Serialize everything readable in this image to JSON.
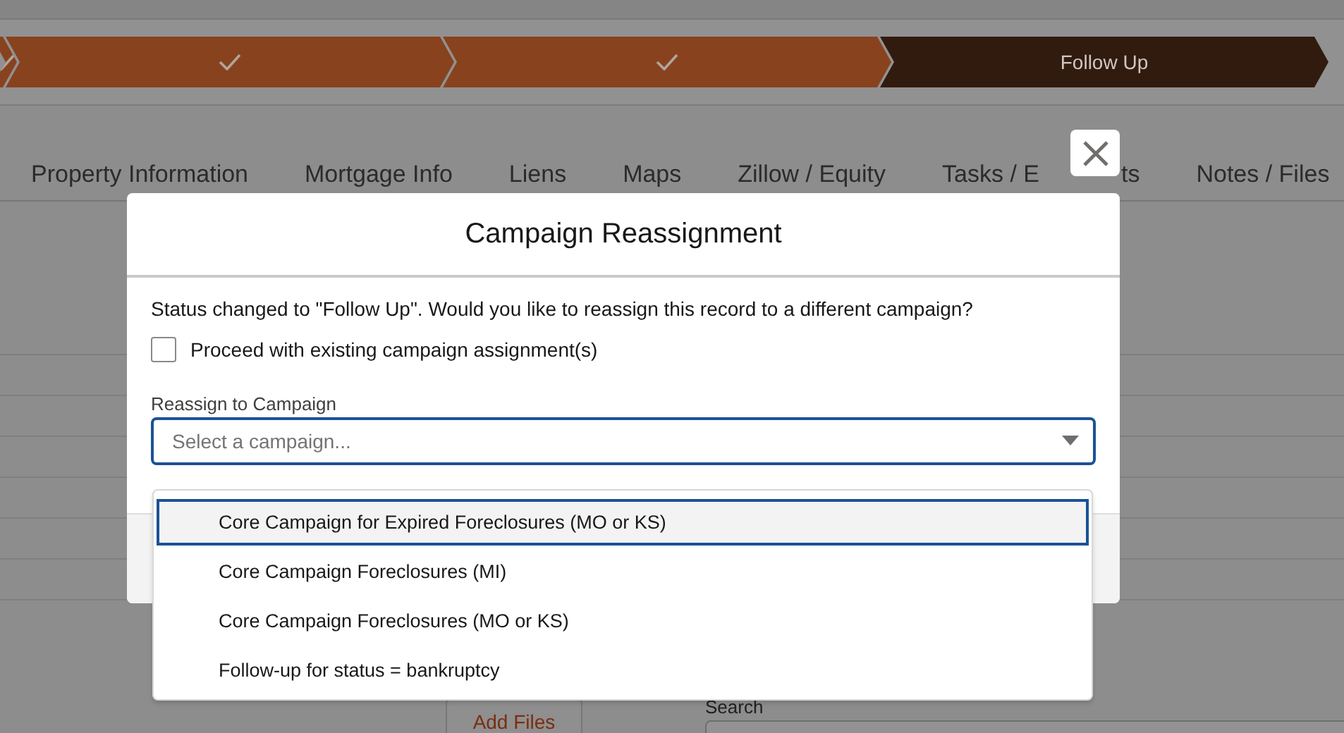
{
  "path_steps": [
    {
      "done": true
    },
    {
      "done": true
    },
    {
      "done": true
    },
    {
      "done": false,
      "label": "Follow Up"
    }
  ],
  "tabs": [
    {
      "label": "Property Information"
    },
    {
      "label": "Mortgage Info"
    },
    {
      "label": "Liens"
    },
    {
      "label": "Maps"
    },
    {
      "label": "Zillow / Equity"
    },
    {
      "label": "Tasks / E",
      "label_tail": "ts"
    },
    {
      "label": "Notes / Files"
    }
  ],
  "background": {
    "add_files_button": "Add Files",
    "search_label": "Search"
  },
  "modal": {
    "title": "Campaign Reassignment",
    "message": "Status changed to \"Follow Up\". Would you like to reassign this record to a different campaign?",
    "checkbox": {
      "label": "Proceed with existing campaign assignment(s)",
      "checked": false
    },
    "select": {
      "label": "Reassign to Campaign",
      "placeholder": "Select a campaign...",
      "options": [
        {
          "label": "Core Campaign for Expired Foreclosures (MO or KS)",
          "selected": true
        },
        {
          "label": "Core Campaign Foreclosures (MI)",
          "selected": false
        },
        {
          "label": "Core Campaign Foreclosures (MO or KS)",
          "selected": false
        },
        {
          "label": "Follow-up for status = bankruptcy",
          "selected": false
        }
      ]
    }
  }
}
